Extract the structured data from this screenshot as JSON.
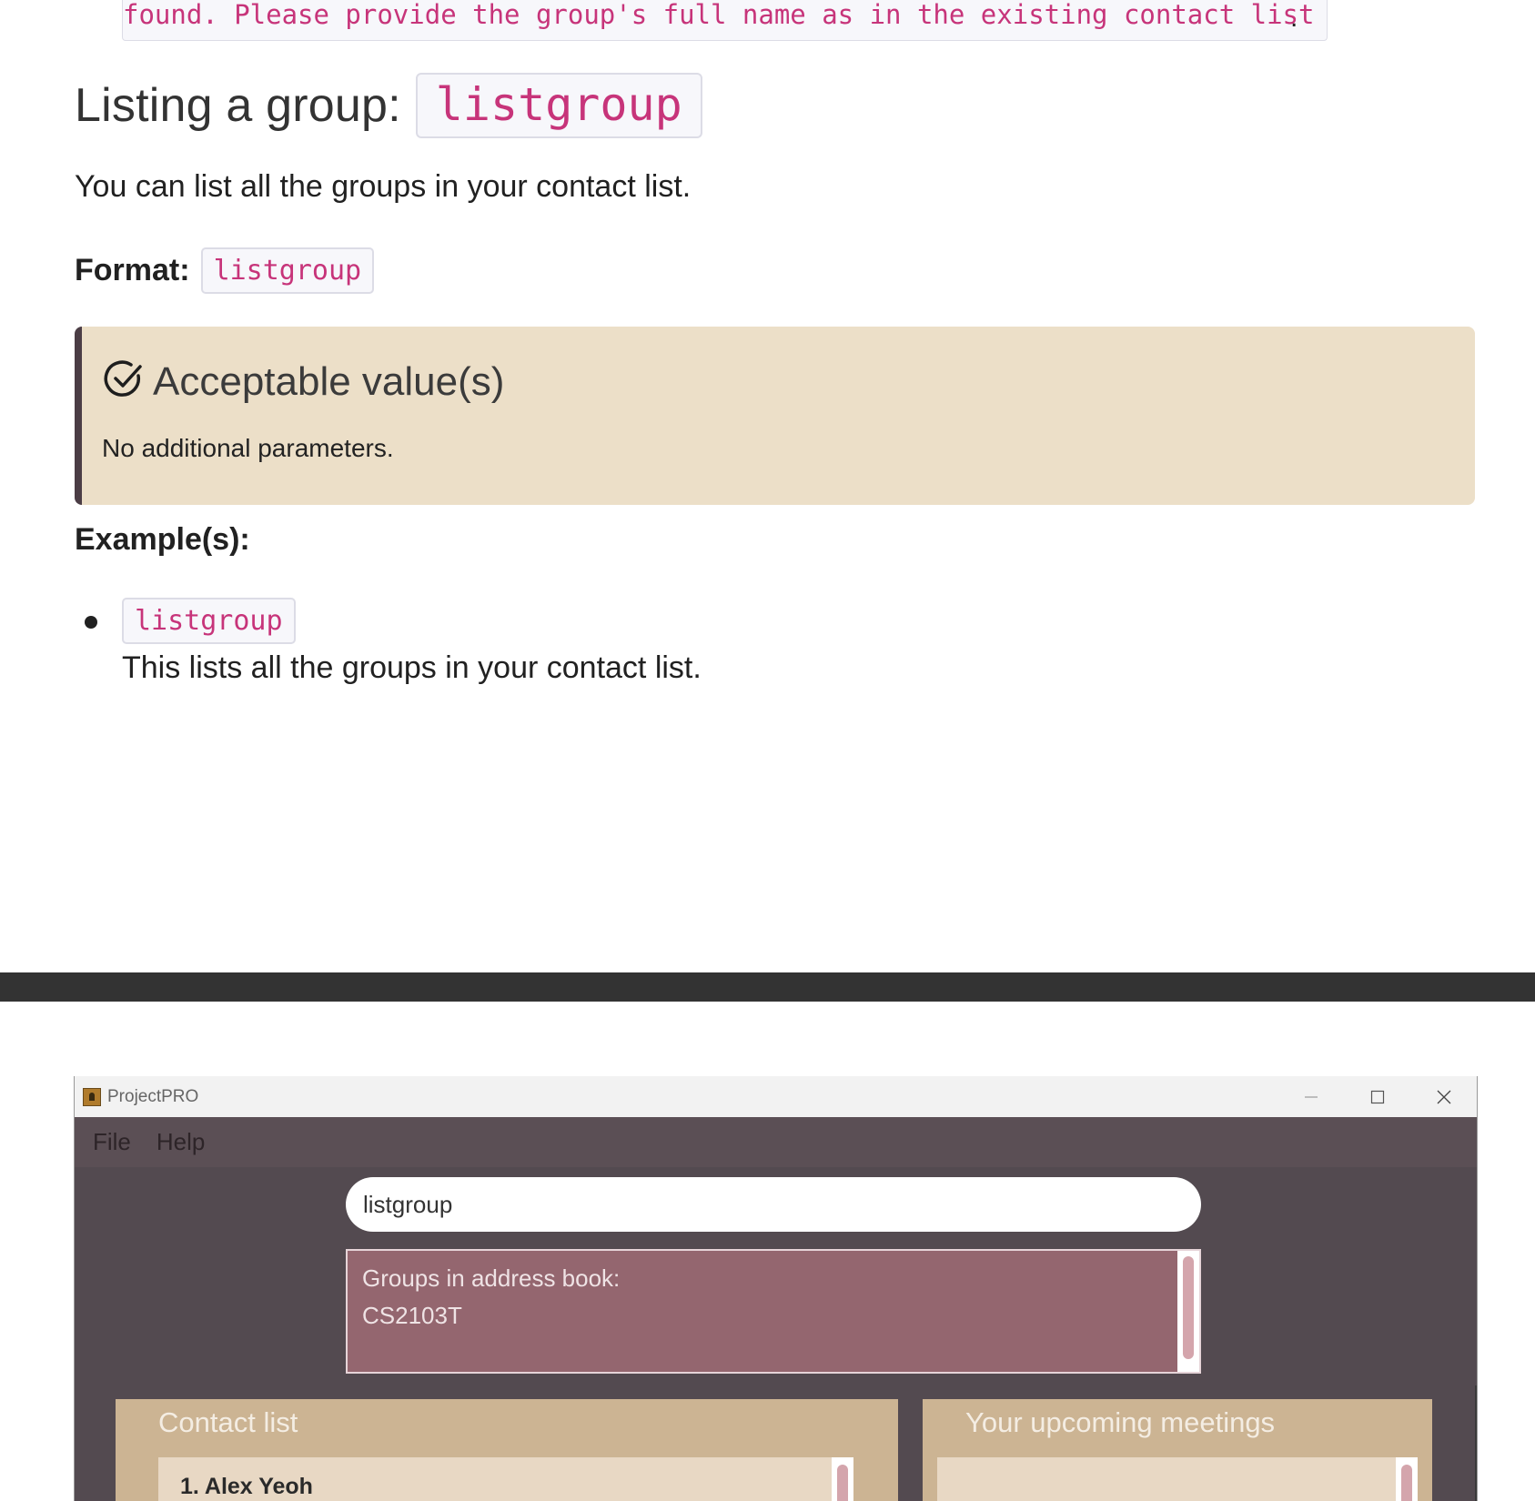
{
  "doc": {
    "prev_line_text": "found. Please provide the group's full name as in the existing contact list",
    "prev_line_end": ".",
    "heading_text": "Listing a group:",
    "heading_code": "listgroup",
    "intro": "You can list all the groups in your contact list.",
    "format_label": "Format:",
    "format_code": "listgroup",
    "callout": {
      "icon": "check-circle-icon",
      "title": "Acceptable value(s)",
      "body": "No additional parameters."
    },
    "examples_label": "Example(s):",
    "examples": [
      {
        "code": "listgroup",
        "description": "This lists all the groups in your contact list."
      }
    ],
    "colors": {
      "code_text": "#c7347a",
      "callout_bg": "#ecdfc8",
      "callout_border": "#4b3d45"
    }
  },
  "app": {
    "window_title": "ProjectPRO",
    "menu": [
      "File",
      "Help"
    ],
    "command_input": "listgroup",
    "result_text": "Groups in address book:\nCS2103T",
    "contact_panel_title": "Contact list",
    "contacts": [
      {
        "index": "1.",
        "name": "Alex Yeoh"
      }
    ],
    "meetings_panel_title": "Your upcoming meetings",
    "colors": {
      "bg": "#534a50",
      "result_bg": "#94666f",
      "panel_bg": "#ccb493",
      "panel_inner": "#e8d8c4"
    }
  }
}
